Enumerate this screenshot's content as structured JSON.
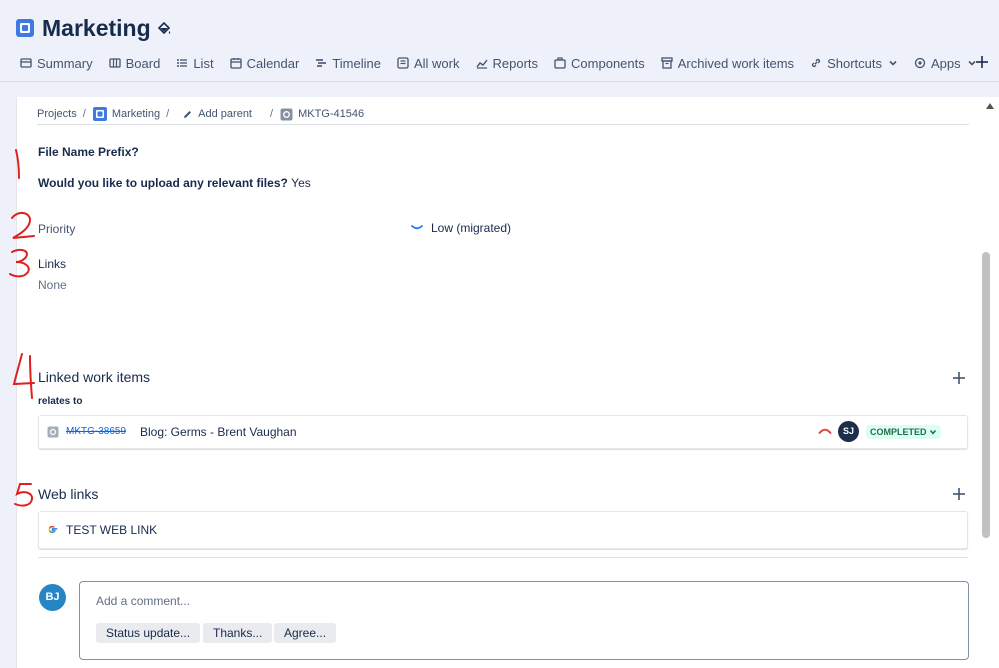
{
  "project": {
    "name": "Marketing"
  },
  "tabs": [
    {
      "label": "Summary",
      "icon": "summary-icon"
    },
    {
      "label": "Board",
      "icon": "board-icon"
    },
    {
      "label": "List",
      "icon": "list-icon"
    },
    {
      "label": "Calendar",
      "icon": "calendar-icon"
    },
    {
      "label": "Timeline",
      "icon": "timeline-icon"
    },
    {
      "label": "All work",
      "icon": "all-work-icon"
    },
    {
      "label": "Reports",
      "icon": "reports-icon"
    },
    {
      "label": "Components",
      "icon": "components-icon"
    },
    {
      "label": "Archived work items",
      "icon": "archive-icon"
    },
    {
      "label": "Shortcuts",
      "icon": "link-icon"
    },
    {
      "label": "Apps",
      "icon": "apps-icon"
    }
  ],
  "breadcrumb": {
    "projects": "Projects",
    "sep": "/",
    "project": "Marketing",
    "add_parent": "Add parent",
    "issue_key": "MKTG-41546"
  },
  "fields": {
    "file_prefix_label": "File Name Prefix?",
    "upload_label": "Would you like to upload any relevant files?",
    "upload_value": "Yes",
    "priority_label": "Priority",
    "priority_value": "Low (migrated)",
    "links_label": "Links",
    "links_value": "None"
  },
  "linked": {
    "title": "Linked work items",
    "relation": "relates to",
    "item": {
      "key": "MKTG-38659",
      "summary": "Blog: Germs - Brent Vaughan",
      "assignee_initials": "SJ",
      "status": "COMPLETED"
    }
  },
  "web_links": {
    "title": "Web links",
    "items": [
      {
        "text": "TEST WEB LINK"
      }
    ]
  },
  "comment": {
    "user_initials": "BJ",
    "placeholder": "Add a comment...",
    "quick_replies": [
      "Status update...",
      "Thanks...",
      "Agree..."
    ]
  },
  "annotations": [
    "1",
    "2",
    "3",
    "4",
    "5"
  ],
  "colors": {
    "accent": "#0c66e4",
    "status_green": "#216e4e",
    "annotation_red": "#e02020",
    "priority_low": "#1d7afc",
    "priority_high": "#e2483d"
  }
}
